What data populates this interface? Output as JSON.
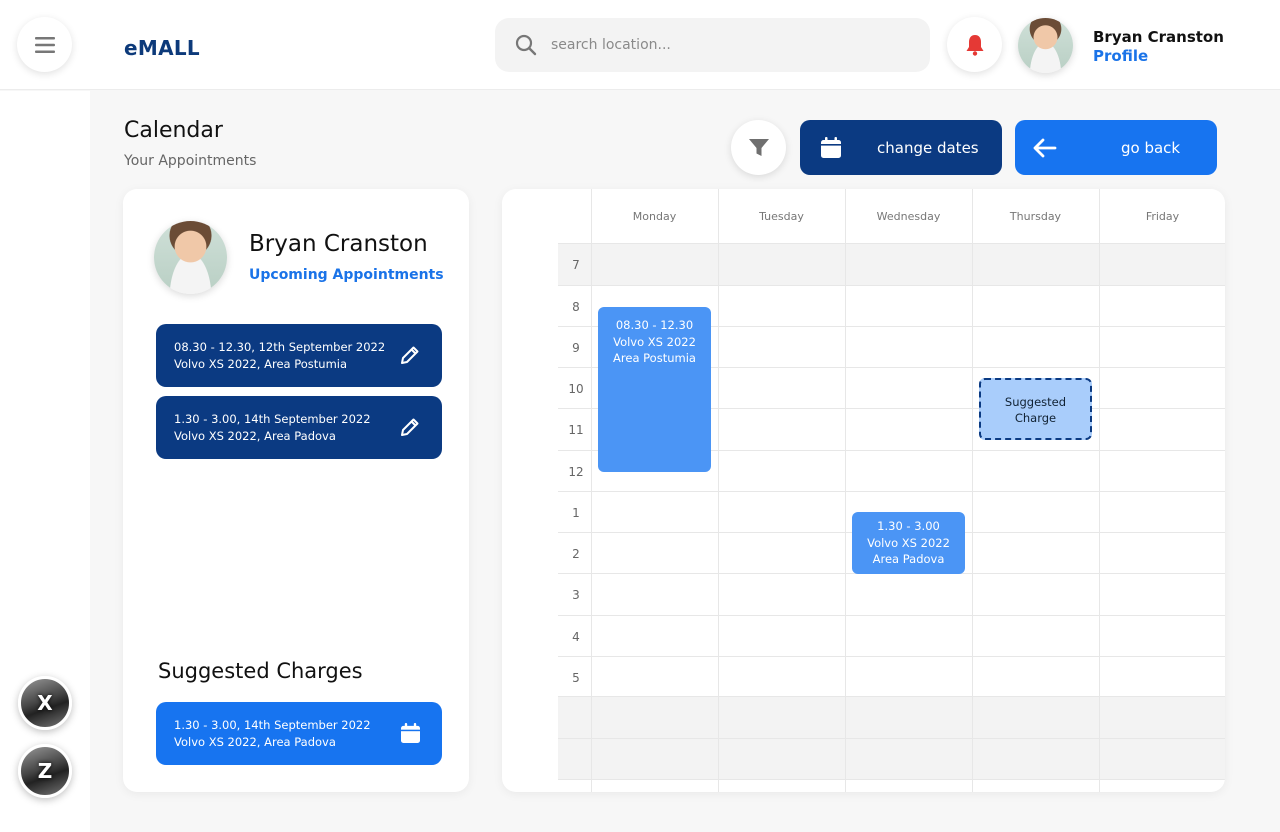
{
  "header": {
    "brand": "eMALL",
    "search_placeholder": "search location...",
    "user_name": "Bryan Cranston",
    "profile_link": "Profile"
  },
  "sidebar": {
    "cars": [
      {
        "label": "X"
      },
      {
        "label": "Z"
      }
    ]
  },
  "page": {
    "title": "Calendar",
    "subtitle": "Your Appointments",
    "change_dates_label": "change dates",
    "go_back_label": "go back"
  },
  "left_card": {
    "name": "Bryan Cranston",
    "upcoming_link": "Upcoming Appointments",
    "appointments": [
      {
        "line1": "08.30 - 12.30, 12th September 2022",
        "line2": "Volvo XS 2022, Area Postumia"
      },
      {
        "line1": "1.30 - 3.00, 14th September 2022",
        "line2": "Volvo XS 2022, Area Padova"
      }
    ],
    "suggested_title": "Suggested Charges",
    "suggested": [
      {
        "line1": "1.30 - 3.00, 14th September 2022",
        "line2": "Volvo XS 2022, Area Padova"
      }
    ]
  },
  "calendar": {
    "days": [
      "Monday",
      "Tuesday",
      "Wednesday",
      "Thursday",
      "Friday"
    ],
    "hours": [
      "7",
      "8",
      "9",
      "10",
      "11",
      "12",
      "1",
      "2",
      "3",
      "4",
      "5"
    ],
    "events": [
      {
        "day": "Monday",
        "line1": "08.30 - 12.30",
        "line2": "Volvo XS 2022",
        "line3": "Area Postumia"
      },
      {
        "day": "Wednesday",
        "line1": "1.30 - 3.00",
        "line2": "Volvo XS 2022",
        "line3": "Area Padova"
      }
    ],
    "suggested_event": {
      "day": "Thursday",
      "line1": "Suggested",
      "line2": "Charge"
    }
  },
  "colors": {
    "navy": "#0b3a82",
    "primary_blue": "#1774f0",
    "event_blue": "#4b95f5",
    "suggested_blue": "#a9cdfb",
    "bell_red": "#e53935"
  },
  "icons": [
    "menu-icon",
    "search-icon",
    "bell-icon",
    "filter-icon",
    "calendar-icon",
    "arrow-left-icon",
    "pencil-icon"
  ]
}
